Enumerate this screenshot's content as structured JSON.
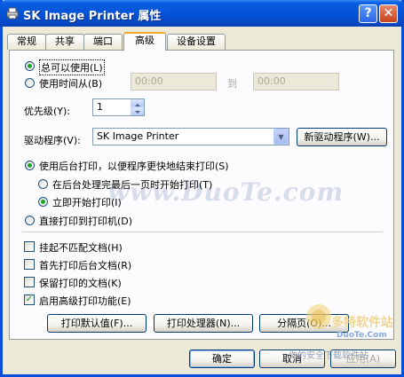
{
  "window": {
    "title": "SK Image Printer 属性"
  },
  "tabs": [
    {
      "label": "常规"
    },
    {
      "label": "共享"
    },
    {
      "label": "端口"
    },
    {
      "label": "高级"
    },
    {
      "label": "设备设置"
    }
  ],
  "availability": {
    "always_label": "总可以使用(L)",
    "time_label": "使用时间从(B)",
    "from_time": "00:00",
    "to_label": "到",
    "to_time": "00:00"
  },
  "priority": {
    "label": "优先级(Y):",
    "value": "1"
  },
  "driver": {
    "label": "驱动程序(V):",
    "selected": "SK Image Printer",
    "new_button": "新驱动程序(W)..."
  },
  "spool": {
    "spool_label": "使用后台打印，以便程序更快地结束打印(S)",
    "after_last_page": "在后台处理完最后一页时开始打印(T)",
    "immediately": "立即开始打印(I)",
    "direct": "直接打印到打印机(D)"
  },
  "options": [
    {
      "label": "挂起不匹配文档(H)",
      "checked": false
    },
    {
      "label": "首先打印后台文档(R)",
      "checked": false
    },
    {
      "label": "保留打印的文档(K)",
      "checked": false
    },
    {
      "label": "启用高级打印功能(E)",
      "checked": true
    }
  ],
  "buttons": {
    "defaults": "打印默认值(F)...",
    "processor": "打印处理器(N)...",
    "separator": "分隔页(O)...",
    "ok": "确定",
    "cancel": "取消",
    "apply": "应用(A)"
  },
  "watermarks": {
    "center": "www.DuoTe.com",
    "logo_text": "多特软件站",
    "logo_url": "DuoTe.Com",
    "footer_text": "你的安全下载软件站"
  },
  "colors": {
    "accent_green": "#21a121",
    "titlebar_blue": "#0553d8"
  }
}
